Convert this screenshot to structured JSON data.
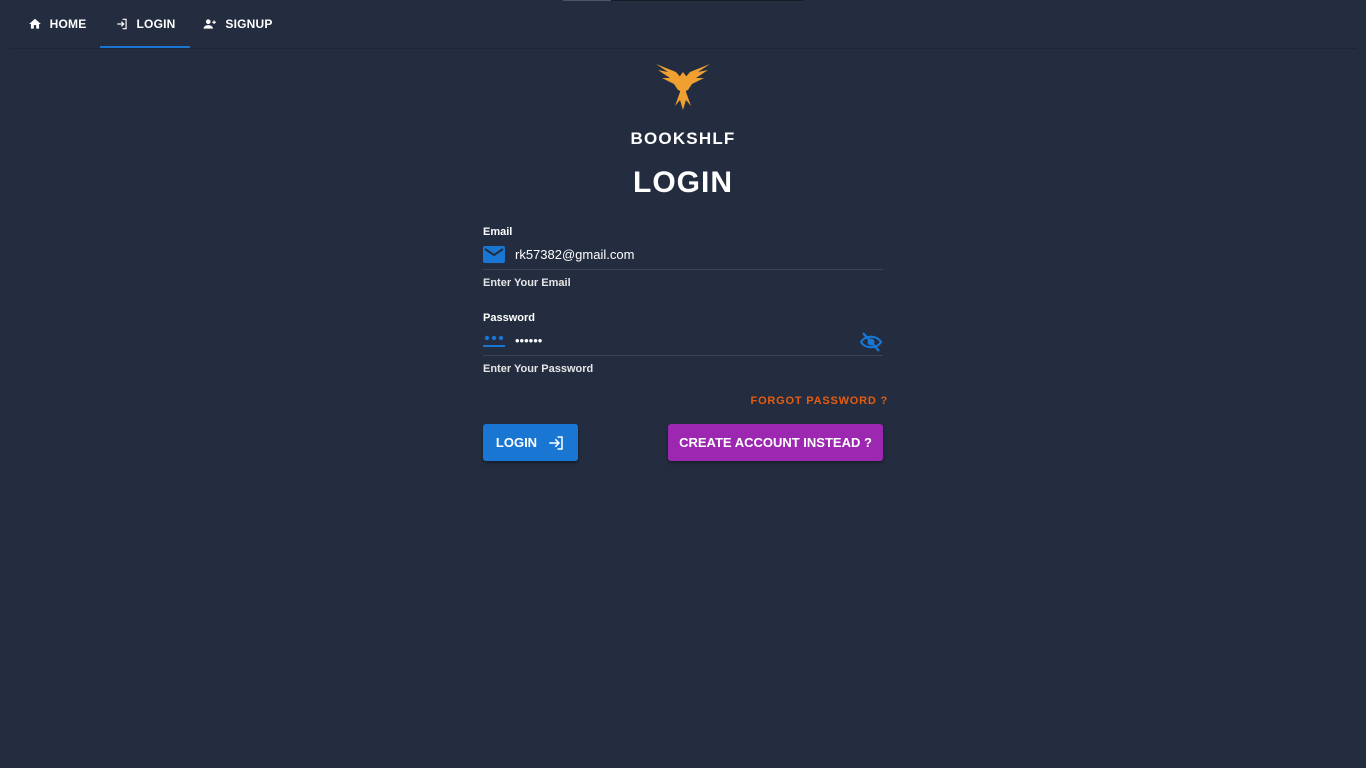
{
  "nav": {
    "tabs": [
      {
        "label": "HOME",
        "icon": "home-icon"
      },
      {
        "label": "LOGIN",
        "icon": "login-icon",
        "active": true
      },
      {
        "label": "SIGNUP",
        "icon": "person-add-icon"
      }
    ]
  },
  "brand": {
    "name": "BOOKSHLF",
    "logo": "eagle-logo"
  },
  "page": {
    "title": "LOGIN"
  },
  "email": {
    "label": "Email",
    "value": "rk57382@gmail.com",
    "helper": "Enter Your Email",
    "icon": "mail-icon"
  },
  "password": {
    "label": "Password",
    "value": "••••••",
    "helper": "Enter Your Password",
    "icon": "password-dots-icon",
    "toggle_icon": "eye-off-icon"
  },
  "links": {
    "forgot": "FORGOT PASSWORD ?"
  },
  "buttons": {
    "login": "LOGIN",
    "create": "CREATE ACCOUNT INSTEAD ?"
  },
  "colors": {
    "background": "#232d3f",
    "primary": "#1976d2",
    "secondary": "#9c27b0",
    "warning": "#e65c0f",
    "logo": "#f0a030"
  }
}
